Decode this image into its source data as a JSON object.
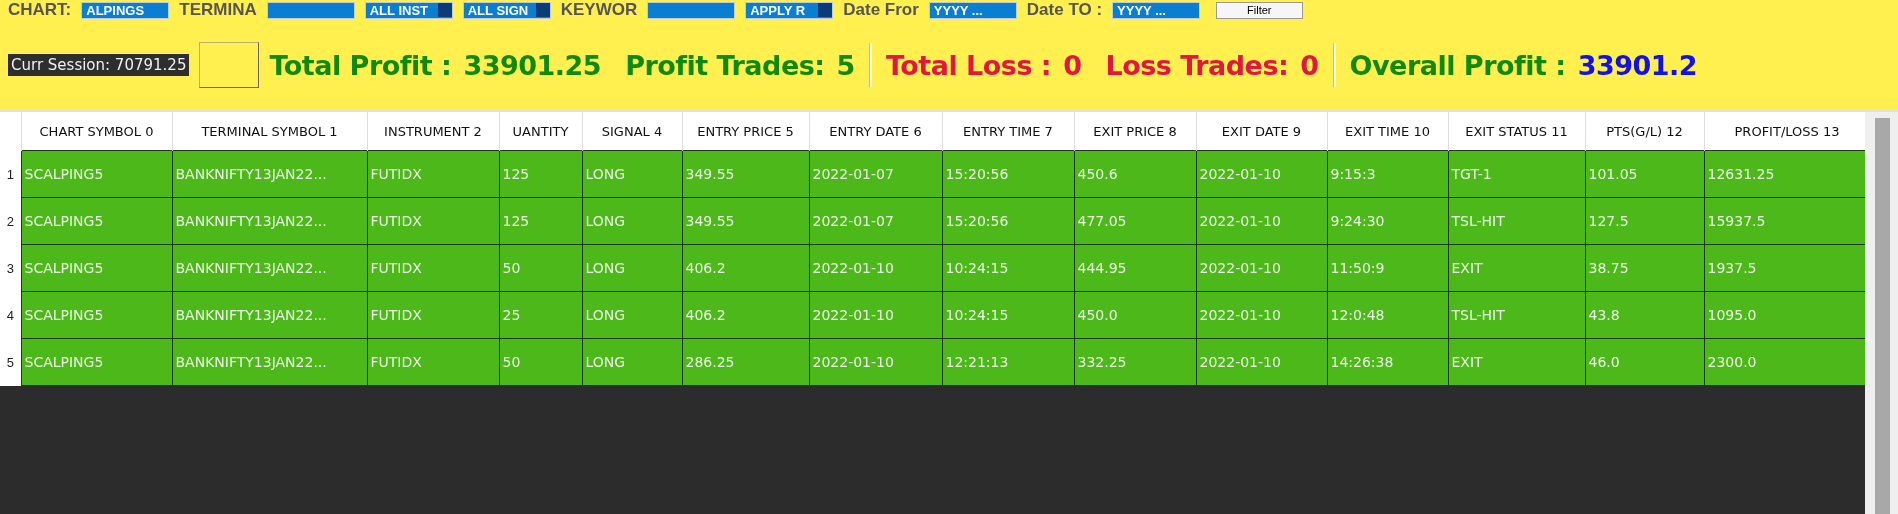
{
  "filter_bar": [
    {
      "kind": "label",
      "text": "CHART:"
    },
    {
      "kind": "field",
      "value": "ALPINGS"
    },
    {
      "kind": "label",
      "text": "TERMINA"
    },
    {
      "kind": "field"
    },
    {
      "kind": "field",
      "value": "ALL INST",
      "dropdown": true
    },
    {
      "kind": "field",
      "value": "ALL SIGN",
      "dropdown": true
    },
    {
      "kind": "label",
      "text": "KEYWOR"
    },
    {
      "kind": "field"
    },
    {
      "kind": "field",
      "value": "APPLY R",
      "dropdown": true
    },
    {
      "kind": "label",
      "text": "Date Fror"
    },
    {
      "kind": "field",
      "value": "YYYY ..."
    },
    {
      "kind": "label",
      "text": "Date TO :"
    },
    {
      "kind": "field",
      "value": "YYYY ..."
    },
    {
      "kind": "button",
      "text": "Filter"
    }
  ],
  "summary": {
    "session": "Curr Session: 70791.25",
    "groups": [
      [
        {
          "kind": "profit",
          "label": "Total Profit :",
          "value": "33901.25"
        },
        {
          "kind": "profit",
          "label": "Profit Trades:",
          "value": "5"
        }
      ],
      [
        {
          "kind": "loss",
          "label": "Total Loss :",
          "value": "0"
        },
        {
          "kind": "loss",
          "label": "Loss Trades:",
          "value": "0"
        }
      ],
      [
        {
          "kind": "overall",
          "label": "Overall Profit :",
          "value": "33901.2"
        }
      ]
    ]
  },
  "table": {
    "columns": [
      "CHART SYMBOL 0",
      "TERMINAL SYMBOL 1",
      "INSTRUMENT 2",
      "UANTITY",
      "SIGNAL 4",
      "ENTRY PRICE 5",
      "ENTRY DATE 6",
      "ENTRY TIME 7",
      "EXIT PRICE 8",
      "EXIT DATE 9",
      "EXIT TIME 10",
      "EXIT STATUS 11",
      "PTS(G/L) 12",
      "PROFIT/LOSS 13"
    ],
    "rows": [
      {
        "number": "1",
        "cells": [
          "SCALPING5",
          "BANKNIFTY13JAN22...",
          "FUTIDX",
          "125",
          "LONG",
          "349.55",
          "2022-01-07",
          "15:20:56",
          "450.6",
          "2022-01-10",
          "9:15:3",
          "TGT-1",
          "101.05",
          "12631.25"
        ]
      },
      {
        "number": "2",
        "cells": [
          "SCALPING5",
          "BANKNIFTY13JAN22...",
          "FUTIDX",
          "125",
          "LONG",
          "349.55",
          "2022-01-07",
          "15:20:56",
          "477.05",
          "2022-01-10",
          "9:24:30",
          "TSL-HIT",
          "127.5",
          "15937.5"
        ]
      },
      {
        "number": "3",
        "cells": [
          "SCALPING5",
          "BANKNIFTY13JAN22...",
          "FUTIDX",
          "50",
          "LONG",
          "406.2",
          "2022-01-10",
          "10:24:15",
          "444.95",
          "2022-01-10",
          "11:50:9",
          "EXIT",
          "38.75",
          "1937.5"
        ]
      },
      {
        "number": "4",
        "cells": [
          "SCALPING5",
          "BANKNIFTY13JAN22...",
          "FUTIDX",
          "25",
          "LONG",
          "406.2",
          "2022-01-10",
          "10:24:15",
          "450.0",
          "2022-01-10",
          "12:0:48",
          "TSL-HIT",
          "43.8",
          "1095.0"
        ]
      },
      {
        "number": "5",
        "cells": [
          "SCALPING5",
          "BANKNIFTY13JAN22...",
          "FUTIDX",
          "50",
          "LONG",
          "286.25",
          "2022-01-10",
          "12:21:13",
          "332.25",
          "2022-01-10",
          "14:26:38",
          "EXIT",
          "46.0",
          "2300.0"
        ]
      }
    ]
  }
}
